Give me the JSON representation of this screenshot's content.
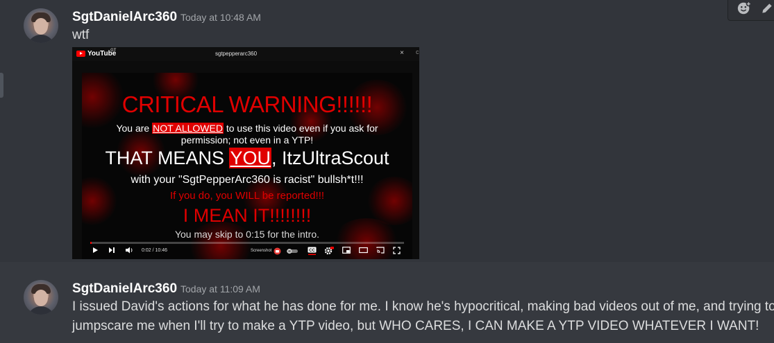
{
  "messages": [
    {
      "username": "SgtDanielArc360",
      "timestamp": "Today at 10:48 AM",
      "content": "wtf"
    },
    {
      "username": "SgtDanielArc360",
      "timestamp": "Today at 11:09 AM",
      "content_line1": "I issued David's actions for what he has done for me. I know he's hypocritical, making bad videos out of me, and trying to",
      "content_line2": "jumpscare me when I'll try to make a YTP video, but WHO CARES, I CAN MAKE A YTP VIDEO WHATEVER I WANT!"
    }
  ],
  "toolbar": {
    "icons": [
      "add-reaction-icon",
      "edit-icon"
    ]
  },
  "attachment": {
    "youtube": {
      "logo_text": "YouTube",
      "logo_sup": "GT",
      "search_value": "sgtpepperarc360",
      "close_glyph": "×",
      "trail_glyph": "c"
    },
    "video": {
      "critical": "CRITICAL WARNING!!!!!!",
      "line1_a": "You are ",
      "line1_highlight": "NOT ALLOWED",
      "line1_b": " to use this video even if you ask for",
      "line2": "permission; not even in a YTP!",
      "you_a": "THAT MEANS ",
      "you_highlight": "YOU",
      "you_b": ", ItzUltraScout",
      "racist": "with your \"SgtPepperArc360 is racist\" bullsh*t!!!",
      "report": "If you do, you WILL be reported!!!",
      "mean": "I MEAN IT!!!!!!!!",
      "skip": "You may skip to 0:15 for the intro."
    },
    "player": {
      "time": "0:02 / 10:46",
      "screenshot_label": "Screenshot",
      "progress": 0.003
    }
  },
  "colors": {
    "background": "#36393f",
    "hover_background": "#32353b",
    "username": "#ffffff",
    "timestamp": "#a3a6aa",
    "text": "#dcddde",
    "warning_red": "#e00000"
  }
}
